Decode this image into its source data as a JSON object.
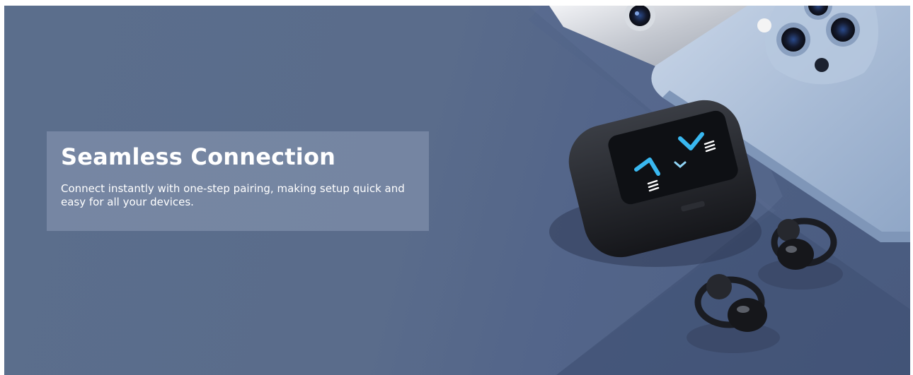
{
  "hero": {
    "title": "Seamless Connection",
    "description": "Connect instantly with one-step pairing, making setup quick and easy for all your devices."
  },
  "colors": {
    "background": "#5a6c8b",
    "text_box": "#8c9bb6",
    "text": "#ffffff",
    "screen_glow": "#39b8f0"
  },
  "icons": [
    "phone-illustration",
    "earbud-case-icon",
    "earbud-icon"
  ]
}
